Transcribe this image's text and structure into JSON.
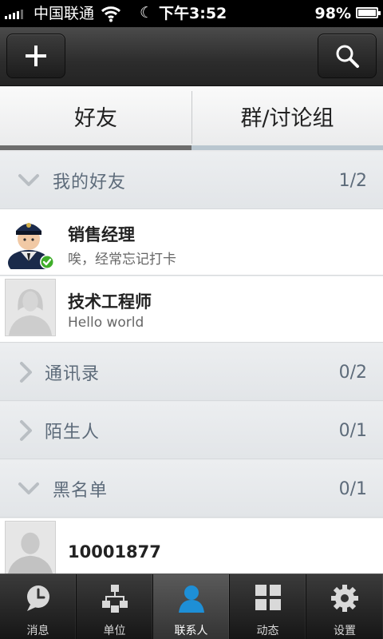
{
  "status_bar": {
    "carrier": "中国联通",
    "time": "下午3:52",
    "battery": "98%",
    "battery_level": 0.98
  },
  "header": {
    "add_icon": "plus-icon",
    "search_icon": "search-icon"
  },
  "tabs": [
    {
      "label": "好友",
      "active": true
    },
    {
      "label": "群/讨论组",
      "active": false
    }
  ],
  "groups": [
    {
      "name": "我的好友",
      "count": "1/2",
      "expanded": true
    },
    {
      "name": "通讯录",
      "count": "0/2",
      "expanded": false
    },
    {
      "name": "陌生人",
      "count": "0/1",
      "expanded": false
    },
    {
      "name": "黑名单",
      "count": "0/1",
      "expanded": true
    }
  ],
  "contacts": [
    {
      "name": "销售经理",
      "status": "唉，经常忘记打卡",
      "online": true
    },
    {
      "name": "技术工程师",
      "status": "Hello world",
      "online": false
    },
    {
      "name": "10001877",
      "status": "",
      "online": false
    }
  ],
  "bottom_nav": [
    {
      "label": "消息",
      "icon": "message-icon",
      "active": false
    },
    {
      "label": "单位",
      "icon": "org-chart-icon",
      "active": false
    },
    {
      "label": "联系人",
      "icon": "person-icon",
      "active": true
    },
    {
      "label": "动态",
      "icon": "grid-icon",
      "active": false
    },
    {
      "label": "设置",
      "icon": "gear-icon",
      "active": false
    }
  ],
  "colors": {
    "header_bg": "#2c2c2c",
    "group_text": "#5d6b7a",
    "active_person": "#1e8fd6",
    "online_badge": "#3fae2a"
  }
}
